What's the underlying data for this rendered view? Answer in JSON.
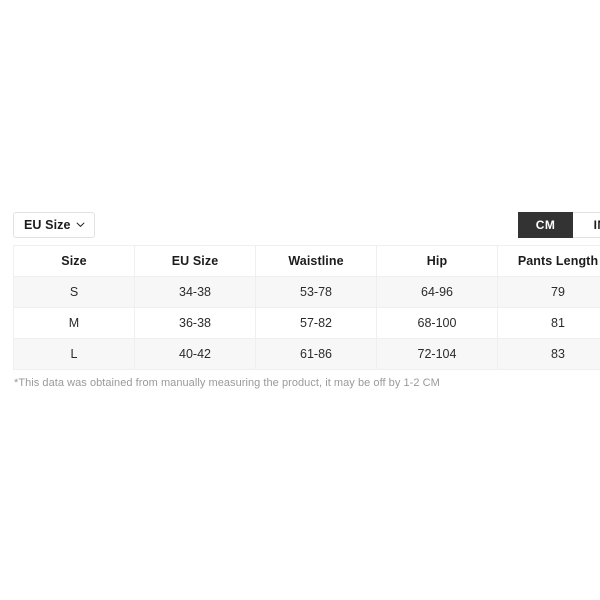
{
  "controls": {
    "size_standard": {
      "label": "EU Size",
      "icon": "chevron-down-icon"
    },
    "unit_toggle": {
      "options": [
        {
          "label": "CM",
          "selected": true
        },
        {
          "label": "IN",
          "selected": false
        }
      ]
    }
  },
  "size_table": {
    "columns": [
      "Size",
      "EU Size",
      "Waistline",
      "Hip",
      "Pants Length"
    ],
    "rows": [
      {
        "size": "S",
        "eu_size": "34-38",
        "waistline": "53-78",
        "hip": "64-96",
        "pants_length": "79"
      },
      {
        "size": "M",
        "eu_size": "36-38",
        "waistline": "57-82",
        "hip": "68-100",
        "pants_length": "81"
      },
      {
        "size": "L",
        "eu_size": "40-42",
        "waistline": "61-86",
        "hip": "72-104",
        "pants_length": "83"
      }
    ]
  },
  "footnote": "*This data was obtained from manually measuring the product, it may be off by 1-2 CM",
  "colors": {
    "page_background": "#ffffff",
    "toggle_active_background": "#333333",
    "toggle_active_text": "#ffffff",
    "row_alt_background": "#f7f7f7",
    "table_border": "#efefef",
    "footnote_text": "#9a9a9a",
    "primary_text": "#1c1c1c"
  }
}
